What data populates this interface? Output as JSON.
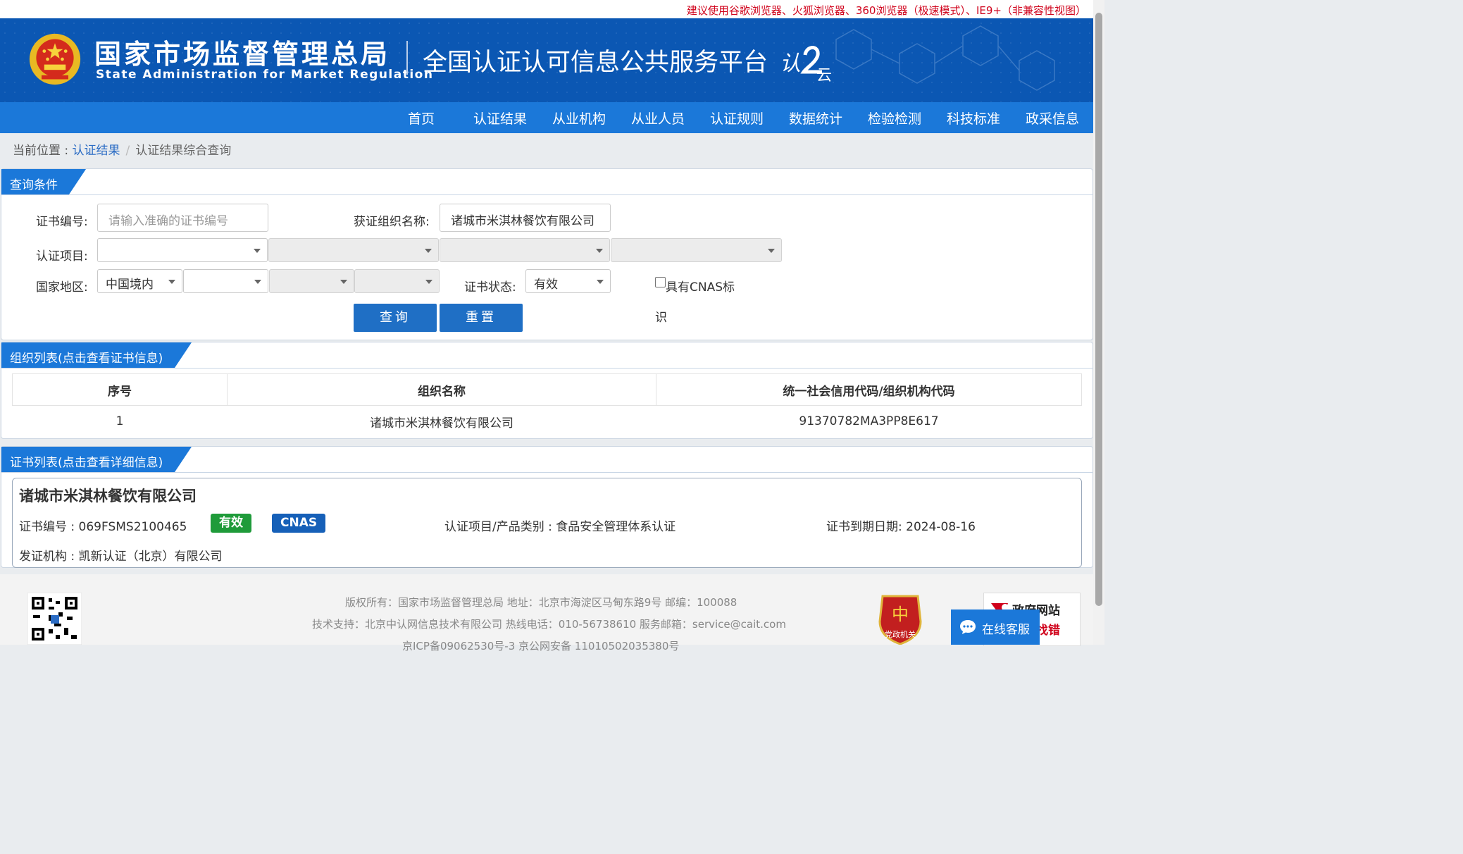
{
  "notice": "建议使用谷歌浏览器、火狐浏览器、360浏览器（极速模式）、IE9+（非兼容性视图）",
  "header": {
    "logo_cn": "国家市场监督管理总局",
    "logo_en": "State Administration  for  Market Regulation",
    "platform": "全国认证认可信息公共服务平台",
    "yun_text": "认证云"
  },
  "nav": [
    "首页",
    "认证结果",
    "从业机构",
    "从业人员",
    "认证规则",
    "数据统计",
    "检验检测",
    "科技标准",
    "政采信息"
  ],
  "breadcrumb": {
    "label": "当前位置 : ",
    "link": "认证结果",
    "sep": "/",
    "current": "认证结果综合查询"
  },
  "query": {
    "title": "查询条件",
    "cert_no_label": "证书编号:",
    "cert_no_placeholder": "请输入准确的证书编号",
    "org_label": "获证组织名称:",
    "org_value": "诸城市米淇林餐饮有限公司",
    "project_label": "认证项目:",
    "region_label": "国家地区:",
    "region_value": "中国境内",
    "status_label": "证书状态:",
    "status_value": "有效",
    "cnas_label_1": "具有CNAS标",
    "cnas_label_2": "识",
    "cnas_checked": false,
    "search_btn": "查询",
    "reset_btn": "重置"
  },
  "orgs": {
    "title": "组织列表(点击查看证书信息)",
    "headers": [
      "序号",
      "组织名称",
      "统一社会信用代码/组织机构代码"
    ],
    "rows": [
      [
        "1",
        "诸城市米淇林餐饮有限公司",
        "91370782MA3PP8E617"
      ]
    ]
  },
  "certs": {
    "title": "证书列表(点击查看详细信息)",
    "company": "诸城市米淇林餐饮有限公司",
    "cert_no": "证书编号 : 069FSMS2100465",
    "status_badge": "有效",
    "cnas_badge": "CNAS",
    "project": "认证项目/产品类别 : 食品安全管理体系认证",
    "expiry": "证书到期日期: 2024-08-16",
    "issuer": "发证机构 : 凯新认证（北京）有限公司"
  },
  "footer": {
    "line1": "版权所有：国家市场监督管理总局    地址：北京市海淀区马甸东路9号    邮编：100088",
    "line2": "技术支持：北京中认网信息技术有限公司    热线电话：010-56738610    服务邮箱：service@cait.com",
    "line3": "京ICP备09062530号-3      京公网安备   11010502035380号",
    "party_label": "党政机关",
    "gov_label_1": "政府网站",
    "gov_label_2": "找错",
    "online_service": "在线客服"
  },
  "colors": {
    "nav_blue": "#1b78d9",
    "header_blue": "#0b57b3",
    "badge_green": "#1f9b3a",
    "badge_blue": "#1660b8",
    "notice_red": "#d0021b"
  }
}
